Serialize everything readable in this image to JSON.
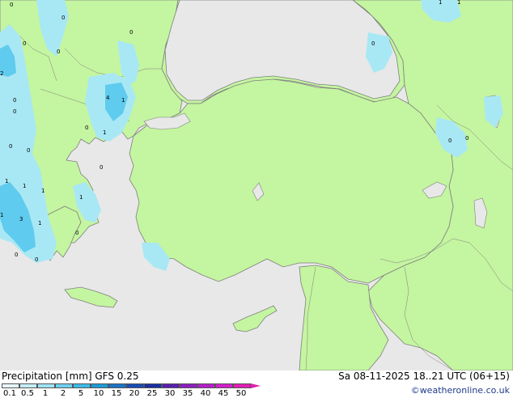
{
  "header": {
    "title": "Precipitation [mm]  GFS 0.25",
    "valid_time": "Sa 08-11-2025 18..21 UTC (06+15)",
    "credit": "©weatheronline.co.uk"
  },
  "legend": {
    "labels": [
      "0.1",
      "0.5",
      "1",
      "2",
      "5",
      "10",
      "15",
      "20",
      "25",
      "30",
      "35",
      "40",
      "45",
      "50"
    ],
    "colors": [
      "#e8f8ff",
      "#c6eef9",
      "#9fe2f5",
      "#6fd0ef",
      "#3cbbe7",
      "#1e9bd6",
      "#1b73c6",
      "#1a4cb3",
      "#1b2fa0",
      "#5a1fb0",
      "#8e1ec0",
      "#b51fc8",
      "#d31fc9",
      "#e21fb3"
    ]
  },
  "map": {
    "colors": {
      "land": "#c4f5a0",
      "sea": "#e8e8e8",
      "coast": "#7f7f7f",
      "precip_light": "#a8e8f4",
      "precip_medium": "#5fcbee"
    },
    "rain_labels": [
      "0",
      "0",
      "0",
      "0",
      "0",
      "2",
      "4",
      "1",
      "0",
      "1",
      "0",
      "0",
      "0",
      "1",
      "1",
      "1",
      "3",
      "1",
      "0",
      "0",
      "0",
      "1",
      "0",
      "1",
      "0",
      "0",
      "0",
      "1",
      "1",
      "0"
    ]
  }
}
